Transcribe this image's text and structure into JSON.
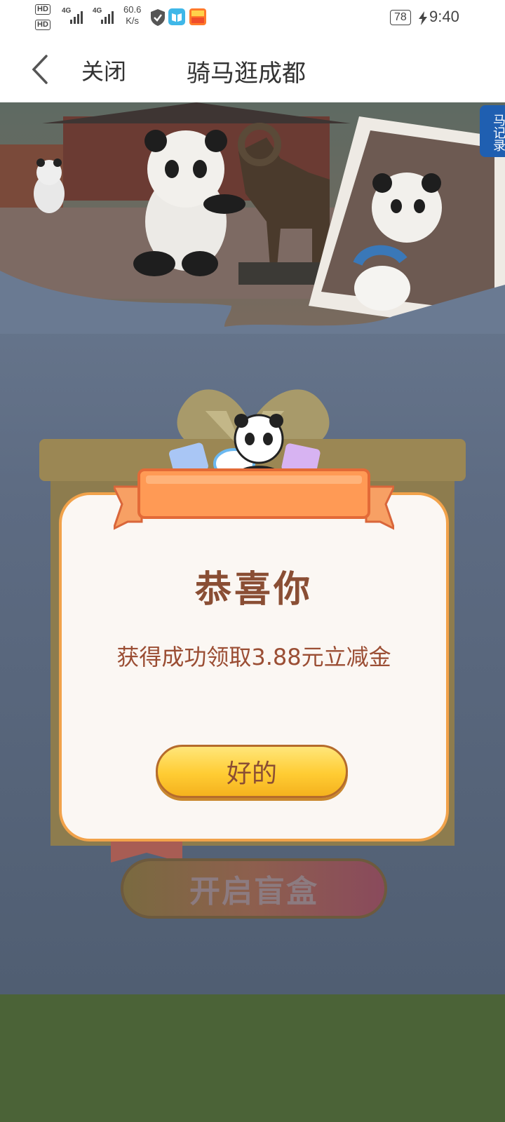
{
  "status_bar": {
    "hd1": "HD",
    "hd2": "HD",
    "net1": "4G",
    "net2": "4G",
    "speed_value": "60.6",
    "speed_unit": "K/s",
    "battery": "78",
    "time": "9:40"
  },
  "nav": {
    "close_label": "关闭",
    "title": "骑马逛成都"
  },
  "hero": {
    "record_tab_label": "马记录"
  },
  "main": {
    "open_box_label": "开启盲盒"
  },
  "dialog": {
    "title": "恭喜你",
    "message": "获得成功领取3.88元立减金",
    "ok_label": "好的"
  },
  "colors": {
    "accent_orange": "#f1a24a",
    "button_yellow": "#ffcc33",
    "text_brown": "#8a4e34",
    "bottom_green": "#4b6337"
  }
}
